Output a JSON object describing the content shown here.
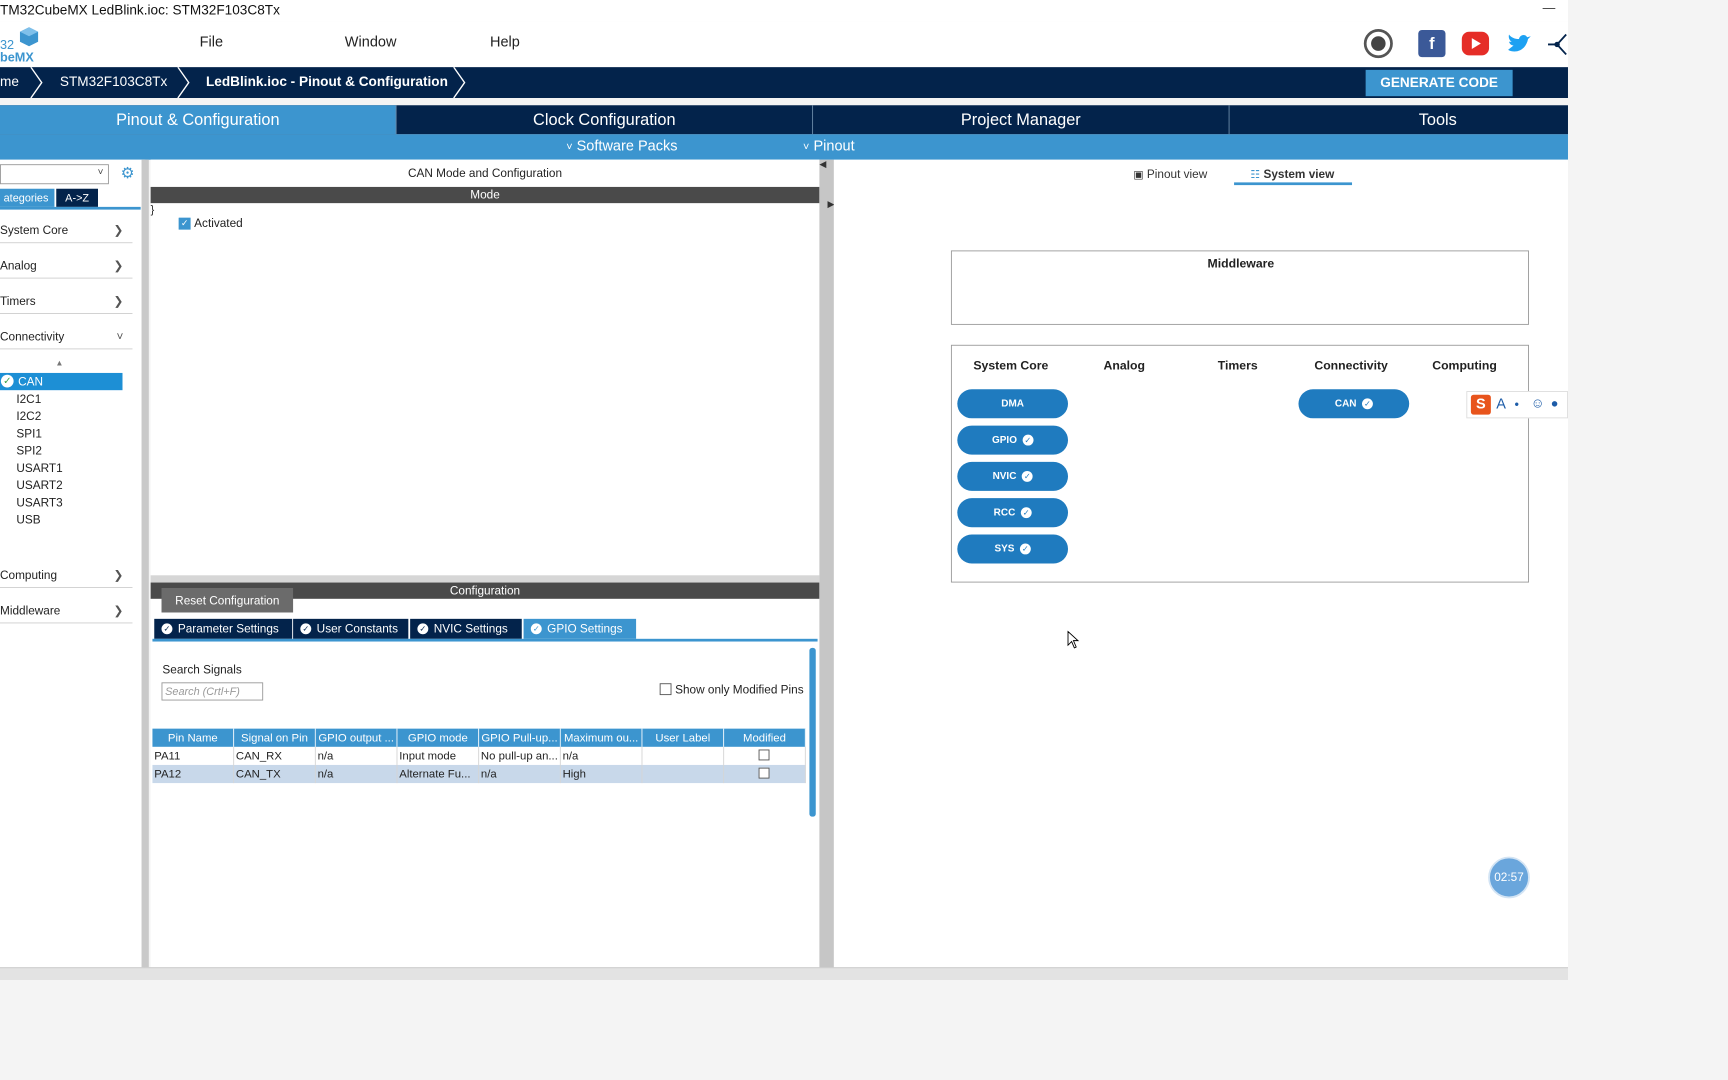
{
  "window": {
    "title": "TM32CubeMX LedBlink.ioc: STM32F103C8Tx",
    "minimize": "—"
  },
  "logo": {
    "line1": "32",
    "line2": "beMX"
  },
  "menu": {
    "items": [
      "File",
      "Window",
      "Help"
    ]
  },
  "breadcrumb": {
    "items": [
      "me",
      "STM32F103C8Tx",
      "LedBlink.ioc - Pinout & Configuration"
    ]
  },
  "generate_button": "GENERATE CODE",
  "main_tabs": [
    "Pinout & Configuration",
    "Clock Configuration",
    "Project Manager",
    "Tools"
  ],
  "sub_tabs": [
    "Software Packs",
    "Pinout"
  ],
  "left": {
    "category_tabs": [
      "ategories",
      "A->Z"
    ],
    "categories_top": [
      "System Core",
      "Analog",
      "Timers",
      "Connectivity"
    ],
    "peripherals": [
      "CAN",
      "I2C1",
      "I2C2",
      "SPI1",
      "SPI2",
      "USART1",
      "USART2",
      "USART3",
      "USB"
    ],
    "categories_bottom": [
      "Computing",
      "Middleware"
    ]
  },
  "mode": {
    "title": "CAN Mode and Configuration",
    "header": "Mode",
    "activated_label": "Activated"
  },
  "config": {
    "header": "Configuration",
    "reset_button": "Reset Configuration",
    "tabs": [
      "Parameter Settings",
      "User Constants",
      "NVIC Settings",
      "GPIO Settings"
    ],
    "search_label": "Search Signals",
    "search_placeholder": "Search (Crtl+F)",
    "show_modified": "Show only Modified Pins",
    "table": {
      "headers": [
        "Pin Name",
        "Signal on Pin",
        "GPIO output ...",
        "GPIO mode",
        "GPIO Pull-up...",
        "Maximum ou...",
        "User Label",
        "Modified"
      ],
      "rows": [
        [
          "PA11",
          "CAN_RX",
          "n/a",
          "Input mode",
          "No pull-up an...",
          "n/a",
          "",
          ""
        ],
        [
          "PA12",
          "CAN_TX",
          "n/a",
          "Alternate Fu...",
          "n/a",
          "High",
          "",
          ""
        ]
      ]
    }
  },
  "right": {
    "view_tabs": [
      "Pinout view",
      "System view"
    ],
    "middleware_title": "Middleware",
    "columns": [
      "System Core",
      "Analog",
      "Timers",
      "Connectivity",
      "Computing"
    ],
    "system_core_pills": [
      "DMA",
      "GPIO",
      "NVIC",
      "RCC",
      "SYS"
    ],
    "connectivity_pills": [
      "CAN"
    ]
  },
  "timer": "02:57",
  "colors": {
    "accent": "#3c95cf",
    "navy": "#03234b",
    "pill": "#1f7bbf"
  }
}
